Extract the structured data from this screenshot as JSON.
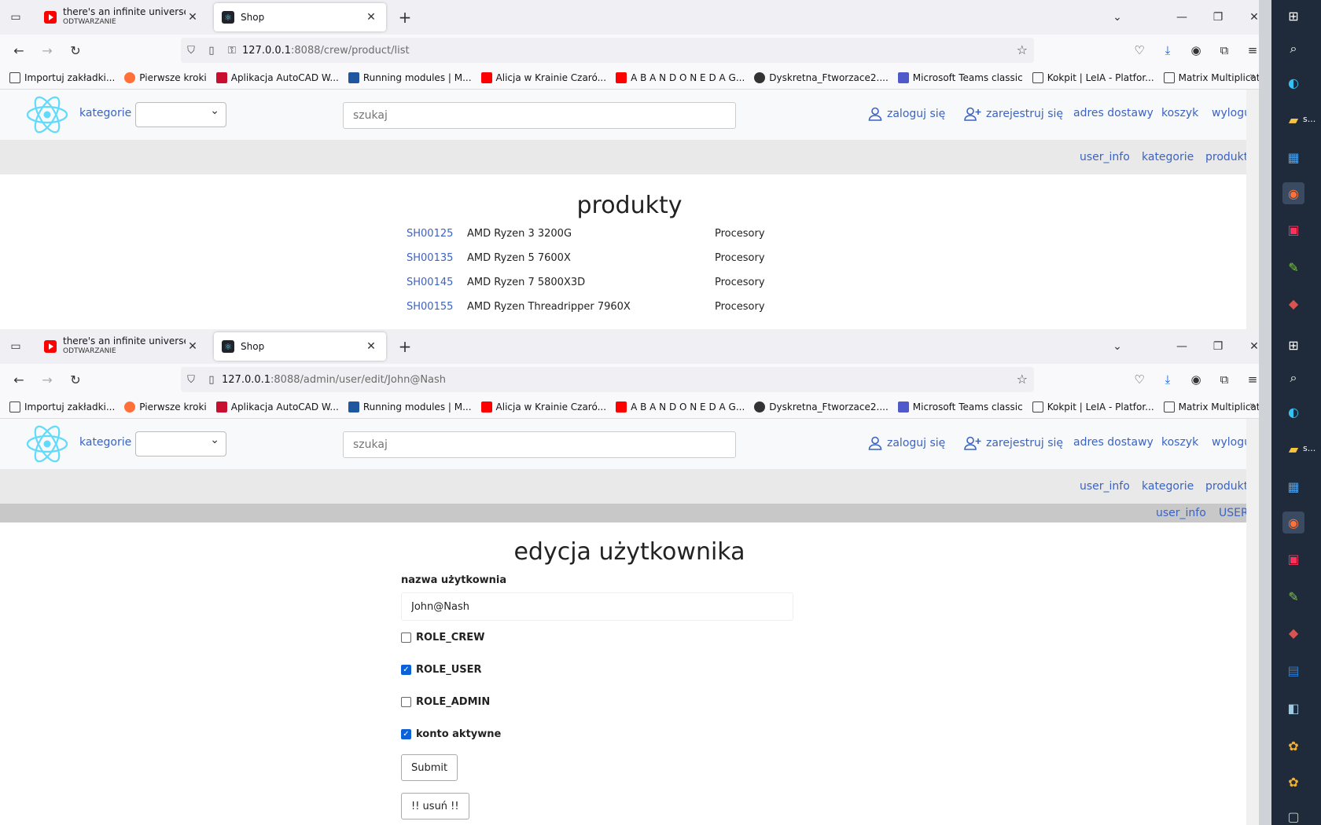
{
  "browser": {
    "tabs": [
      {
        "title": "there's an infinite universe up th",
        "subtitle": "ODTWARZANIE"
      },
      {
        "title": "Shop"
      }
    ],
    "bookmarks": [
      "Importuj zakładki...",
      "Pierwsze kroki",
      "Aplikacja AutoCAD W...",
      "Running modules | M...",
      "Alicja w Krainie Czaró...",
      "A B A N D O N E D A G...",
      "Dyskretna_Ftworzace2....",
      "Microsoft Teams classic",
      "Kokpit | LeIA - Platfor...",
      "Matrix Multiplication ..."
    ]
  },
  "window1": {
    "url_host": "127.0.0.1",
    "url_rest": ":8088/crew/product/list",
    "header": {
      "kategorie": "kategorie",
      "search_placeholder": "szukaj",
      "login": "zaloguj się",
      "register": "zarejestruj się",
      "address": "adres dostawy",
      "cart": "koszyk",
      "logout": "wyloguj"
    },
    "subnav": [
      "user_info",
      "kategorie",
      "produkty"
    ],
    "title": "produkty",
    "products": [
      {
        "code": "SH00125",
        "name": "AMD Ryzen 3 3200G",
        "category": "Procesory"
      },
      {
        "code": "SH00135",
        "name": "AMD Ryzen 5 7600X",
        "category": "Procesory"
      },
      {
        "code": "SH00145",
        "name": "AMD Ryzen 7 5800X3D",
        "category": "Procesory"
      },
      {
        "code": "SH00155",
        "name": "AMD Ryzen Threadripper 7960X",
        "category": "Procesory"
      }
    ]
  },
  "window2": {
    "url_host": "127.0.0.1",
    "url_rest": ":8088/admin/user/edit/John@Nash",
    "header": {
      "kategorie": "kategorie",
      "search_placeholder": "szukaj",
      "login": "zaloguj się",
      "register": "zarejestruj się",
      "address": "adres dostawy",
      "cart": "koszyk",
      "logout": "wyloguj"
    },
    "subnav": [
      "user_info",
      "kategorie",
      "produkty"
    ],
    "subnav2": [
      "user_info",
      "USERS"
    ],
    "title": "edycja użytkownika",
    "form": {
      "username_label": "nazwa użytkownia",
      "username_value": "John@Nash",
      "roles": [
        {
          "label": "ROLE_CREW",
          "checked": false
        },
        {
          "label": "ROLE_USER",
          "checked": true
        },
        {
          "label": "ROLE_ADMIN",
          "checked": false
        },
        {
          "label": "konto aktywne",
          "checked": true
        }
      ],
      "submit": "Submit",
      "delete": "!! usuń !!"
    }
  },
  "taskbar": {
    "items_label": "s..."
  }
}
